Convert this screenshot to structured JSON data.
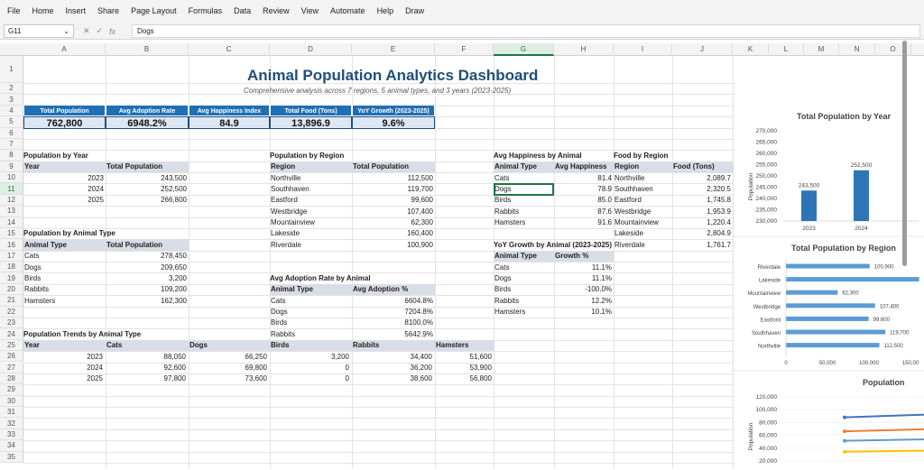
{
  "menu": [
    "File",
    "Home",
    "Insert",
    "Share",
    "Page Layout",
    "Formulas",
    "Data",
    "Review",
    "View",
    "Automate",
    "Help",
    "Draw"
  ],
  "formula_bar": {
    "cell_ref": "G11",
    "value": "Dogs",
    "fx": "fx"
  },
  "columns": [
    "A",
    "B",
    "C",
    "D",
    "E",
    "F",
    "G",
    "H",
    "I",
    "J",
    "K",
    "L",
    "M",
    "N",
    "O"
  ],
  "selected_column": "G",
  "selected_row": 11,
  "title": "Animal Population Analytics Dashboard",
  "subtitle": "Comprehensive analysis across 7 regions, 5 animal types, and 3 years (2023-2025)",
  "kpis": [
    {
      "label": "Total Population",
      "value": "762,800"
    },
    {
      "label": "Avg Adoption Rate",
      "value": "6948.2%"
    },
    {
      "label": "Avg Happiness Index",
      "value": "84.9"
    },
    {
      "label": "Total Food (Tons)",
      "value": "13,896.9"
    },
    {
      "label": "YoY Growth (2023-2025)",
      "value": "9.6%"
    }
  ],
  "pop_by_year": {
    "title": "Population by Year",
    "headers": [
      "Year",
      "Total Population"
    ],
    "rows": [
      [
        "2023",
        "243,500"
      ],
      [
        "2024",
        "252,500"
      ],
      [
        "2025",
        "266,800"
      ]
    ]
  },
  "pop_by_animal": {
    "title": "Population by Animal Type",
    "headers": [
      "Animal Type",
      "Total Population"
    ],
    "rows": [
      [
        "Cats",
        "278,450"
      ],
      [
        "Dogs",
        "209,650"
      ],
      [
        "Birds",
        "3,200"
      ],
      [
        "Rabbits",
        "109,200"
      ],
      [
        "Hamsters",
        "162,300"
      ]
    ]
  },
  "pop_trends": {
    "title": "Population Trends by Animal Type",
    "headers": [
      "Year",
      "Cats",
      "Dogs",
      "Birds",
      "Rabbits",
      "Hamsters"
    ],
    "rows": [
      [
        "2023",
        "88,050",
        "66,250",
        "3,200",
        "34,400",
        "51,600"
      ],
      [
        "2024",
        "92,600",
        "69,800",
        "0",
        "36,200",
        "53,900"
      ],
      [
        "2025",
        "97,800",
        "73,600",
        "0",
        "38,600",
        "56,800"
      ]
    ]
  },
  "pop_by_region": {
    "title": "Population by Region",
    "headers": [
      "Region",
      "Total Population"
    ],
    "rows": [
      [
        "Northville",
        "112,500"
      ],
      [
        "Southhaven",
        "119,700"
      ],
      [
        "Eastford",
        "99,600"
      ],
      [
        "Westbridge",
        "107,400"
      ],
      [
        "Mountainview",
        "62,300"
      ],
      [
        "Lakeside",
        "160,400"
      ],
      [
        "Riverdale",
        "100,900"
      ]
    ]
  },
  "adoption": {
    "title": "Avg Adoption Rate by Animal",
    "headers": [
      "Animal Type",
      "Avg Adoption %"
    ],
    "rows": [
      [
        "Cats",
        "6604.8%"
      ],
      [
        "Dogs",
        "7204.8%"
      ],
      [
        "Birds",
        "8100.0%"
      ],
      [
        "Rabbits",
        "5642.9%"
      ],
      [
        "Hamsters",
        "8285.7%"
      ]
    ]
  },
  "happiness": {
    "title": "Avg Happiness by Animal",
    "headers": [
      "Animal Type",
      "Avg Happiness"
    ],
    "rows": [
      [
        "Cats",
        "81.4"
      ],
      [
        "Dogs",
        "78.9"
      ],
      [
        "Birds",
        "85.0"
      ],
      [
        "Rabbits",
        "87.6"
      ],
      [
        "Hamsters",
        "91.6"
      ]
    ]
  },
  "food": {
    "title": "Food by Region",
    "headers": [
      "Region",
      "Food (Tons)"
    ],
    "rows": [
      [
        "Northville",
        "2,089.7"
      ],
      [
        "Southhaven",
        "2,320.5"
      ],
      [
        "Eastford",
        "1,745.8"
      ],
      [
        "Westbridge",
        "1,953.9"
      ],
      [
        "Mountainview",
        "1,220.4"
      ],
      [
        "Lakeside",
        "2,804.9"
      ],
      [
        "Riverdale",
        "1,761.7"
      ]
    ]
  },
  "yoy": {
    "title": "YoY Growth by Animal (2023-2025)",
    "headers": [
      "Animal Type",
      "Growth %"
    ],
    "rows": [
      [
        "Cats",
        "11.1%"
      ],
      [
        "Dogs",
        "11.1%"
      ],
      [
        "Birds",
        "-100.0%"
      ],
      [
        "Rabbits",
        "12.2%"
      ],
      [
        "Hamsters",
        "10.1%"
      ]
    ]
  },
  "chart_data": [
    {
      "type": "bar",
      "title": "Total Population by Year",
      "ylabel": "Population",
      "categories": [
        "2023",
        "2024"
      ],
      "values": [
        243500,
        252500
      ],
      "data_labels": [
        "243,500",
        "252,500"
      ],
      "ylim": [
        230000,
        270000
      ],
      "yticks": [
        "270,000",
        "265,000",
        "260,000",
        "255,000",
        "250,000",
        "245,000",
        "240,000",
        "235,000",
        "230,000"
      ],
      "color": "#2e75b6"
    },
    {
      "type": "bar",
      "title": "Total Population by Region",
      "orientation": "horizontal",
      "categories": [
        "Riverdale",
        "Lakeside",
        "Mountainview",
        "Westbridge",
        "Eastford",
        "Southhaven",
        "Northville"
      ],
      "values": [
        100900,
        160400,
        62300,
        107400,
        99600,
        119700,
        112500
      ],
      "data_labels": [
        "100,900",
        "",
        "62,300",
        "107,400",
        "99,600",
        "119,700",
        "112,500"
      ],
      "xlim": [
        0,
        150000
      ],
      "xticks": [
        "0",
        "50,000",
        "100,000",
        "150,00"
      ],
      "color": "#5b9bd5"
    },
    {
      "type": "line",
      "title": "Population",
      "ylabel": "Population",
      "yticks": [
        "120,000",
        "100,000",
        "80,000",
        "60,000",
        "40,000",
        "20,000"
      ],
      "ylim": [
        20000,
        120000
      ],
      "series": [
        {
          "values": [
            88050,
            92600
          ],
          "color": "#4472c4"
        },
        {
          "values": [
            66250,
            69800
          ],
          "color": "#ed7d31"
        },
        {
          "values": [
            51600,
            53900
          ],
          "color": "#5b9bd5"
        },
        {
          "values": [
            34400,
            36200
          ],
          "color": "#ffc000"
        }
      ]
    }
  ]
}
